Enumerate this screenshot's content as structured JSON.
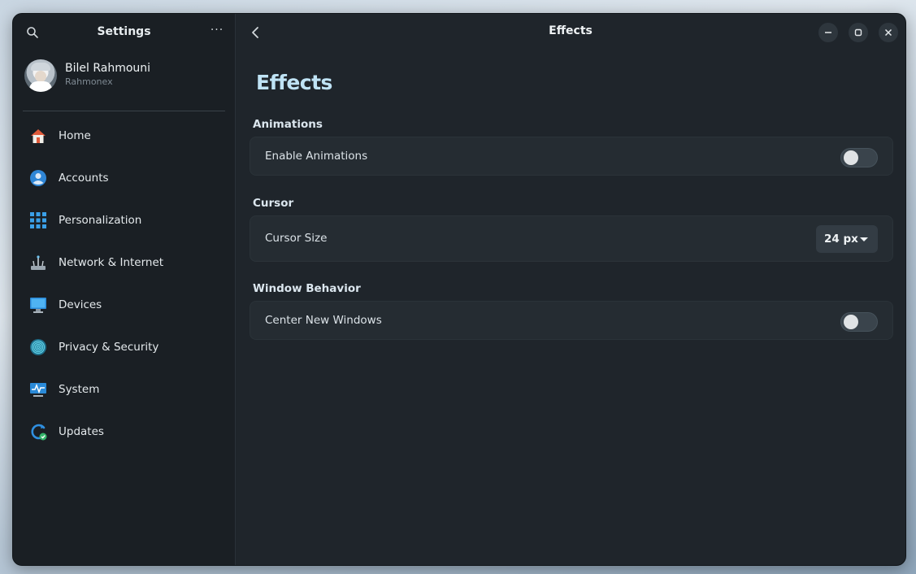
{
  "sidebar": {
    "title": "Settings",
    "more_icon": "more-horizontal-icon",
    "search_icon": "search-icon",
    "profile": {
      "name": "Bilel Rahmouni",
      "handle": "Rahmonex"
    },
    "items": [
      {
        "label": "Home",
        "icon": "home-icon"
      },
      {
        "label": "Accounts",
        "icon": "account-icon"
      },
      {
        "label": "Personalization",
        "icon": "grid-icon"
      },
      {
        "label": "Network & Internet",
        "icon": "network-icon"
      },
      {
        "label": "Devices",
        "icon": "monitor-icon"
      },
      {
        "label": "Privacy & Security",
        "icon": "fingerprint-icon"
      },
      {
        "label": "System",
        "icon": "system-monitor-icon"
      },
      {
        "label": "Updates",
        "icon": "update-icon"
      }
    ]
  },
  "header": {
    "title": "Effects"
  },
  "page": {
    "title": "Effects",
    "sections": [
      {
        "title": "Animations",
        "row": {
          "label": "Enable Animations",
          "type": "toggle",
          "on": false
        }
      },
      {
        "title": "Cursor",
        "row": {
          "label": "Cursor Size",
          "type": "dropdown",
          "value": "24 px"
        }
      },
      {
        "title": "Window Behavior",
        "row": {
          "label": "Center New Windows",
          "type": "toggle",
          "on": false
        }
      }
    ]
  },
  "colors": {
    "accent": "#bfe3f5",
    "background": "#1f252b",
    "sidebar": "#1a1f24",
    "card": "#252c32"
  }
}
